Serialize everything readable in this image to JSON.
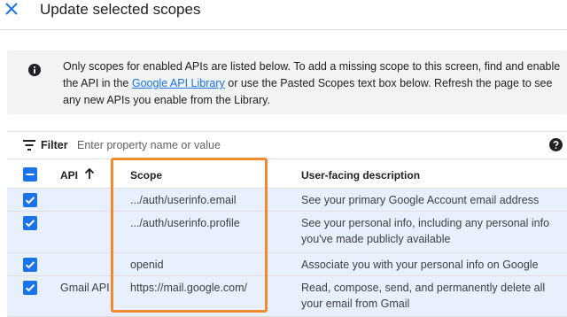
{
  "dialog": {
    "title": "Update selected scopes"
  },
  "info": {
    "text_before": "Only scopes for enabled APIs are listed below. To add a missing scope to this screen, find and enable the API in the ",
    "link_text": "Google API Library",
    "text_after": " or use the Pasted Scopes text box below. Refresh the page to see any new APIs you enable from the Library."
  },
  "filter": {
    "label": "Filter",
    "placeholder": "Enter property name or value"
  },
  "table": {
    "headers": {
      "api": "API",
      "scope": "Scope",
      "description": "User-facing description"
    },
    "rows": [
      {
        "api": "",
        "scope": ".../auth/userinfo.email",
        "description": "See your primary Google Account email address",
        "checked": true
      },
      {
        "api": "",
        "scope": ".../auth/userinfo.profile",
        "description": "See your personal info, including any personal info you've made publicly available",
        "checked": true
      },
      {
        "api": "",
        "scope": "openid",
        "description": "Associate you with your personal info on Google",
        "checked": true
      },
      {
        "api": "Gmail API",
        "scope": "https://mail.google.com/",
        "description": "Read, compose, send, and permanently delete all your email from Gmail",
        "checked": true
      }
    ]
  },
  "colors": {
    "accent": "#1a73e8",
    "selected_row": "#e8f0fe",
    "info_bg": "#f1f3f4",
    "highlight": "#f28a2e"
  },
  "icons": {
    "close": "close-icon",
    "info": "info-icon",
    "filter": "filter-icon",
    "help": "help-icon",
    "sort": "arrow-up-icon"
  }
}
